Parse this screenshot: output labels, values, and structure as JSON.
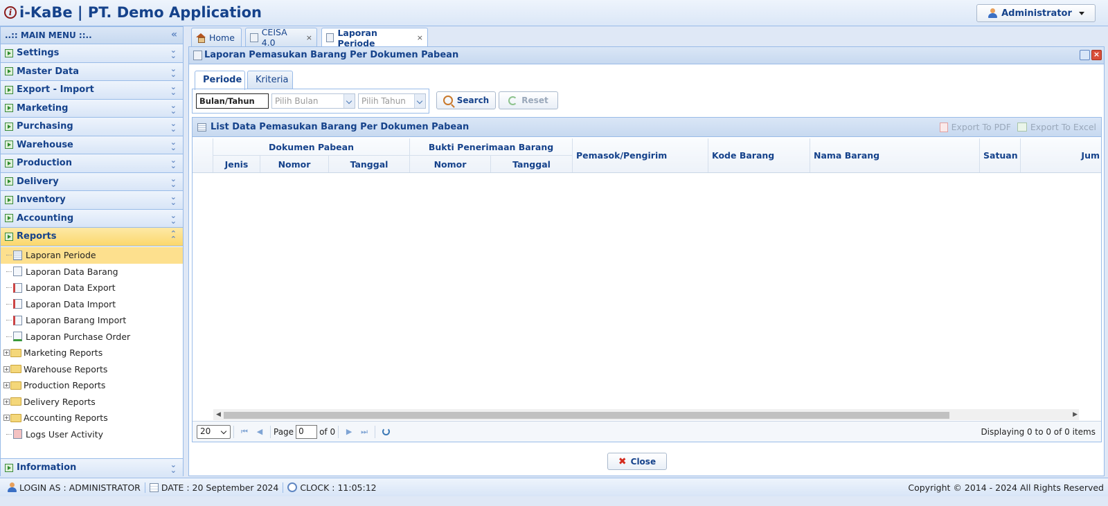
{
  "header": {
    "logo_letter": "i",
    "title": "i-KaBe | PT. Demo Application",
    "user_button": "Administrator"
  },
  "sidebar": {
    "title": "..:: MAIN MENU ::..",
    "menu": [
      "Settings",
      "Master Data",
      "Export - Import",
      "Marketing",
      "Purchasing",
      "Warehouse",
      "Production",
      "Delivery",
      "Inventory",
      "Accounting",
      "Reports"
    ],
    "reports_items": [
      "Laporan Periode",
      "Laporan Data Barang",
      "Laporan Data Export",
      "Laporan Data Import",
      "Laporan Barang Import",
      "Laporan Purchase Order"
    ],
    "report_folders": [
      "Marketing Reports",
      "Warehouse Reports",
      "Production Reports",
      "Delivery Reports",
      "Accounting Reports"
    ],
    "logs_item": "Logs User Activity",
    "information": "Information"
  },
  "tabs": [
    {
      "label": "Home",
      "icon": "home-icon"
    },
    {
      "label": "CEISA 4.0",
      "icon": "pen-icon"
    },
    {
      "label": "Laporan Periode",
      "icon": "calendar-icon",
      "active": true
    }
  ],
  "panel": {
    "title": "Laporan Pemasukan Barang Per Dokumen Pabean",
    "subtabs": [
      "Periode",
      "Kriteria"
    ],
    "filter": {
      "label": "Bulan/Tahun",
      "month_placeholder": "Pilih Bulan",
      "year_placeholder": "Pilih Tahun"
    },
    "search_button": "Search",
    "reset_button": "Reset",
    "grid": {
      "title": "List Data Pemasukan Barang Per Dokumen Pabean",
      "export_pdf": "Export To PDF",
      "export_excel": "Export To Excel",
      "group_dokumen": "Dokumen Pabean",
      "group_bukti": "Bukti Penerimaan Barang",
      "col_jenis": "Jenis",
      "col_nomor": "Nomor",
      "col_tanggal": "Tanggal",
      "col_pemasok": "Pemasok/Pengirim",
      "col_kode": "Kode Barang",
      "col_nama": "Nama Barang",
      "col_satuan": "Satuan",
      "col_jumlah": "Jum"
    },
    "pager": {
      "page_size": "20",
      "page_label": "Page",
      "page_value": "0",
      "of_label": "of 0",
      "display": "Displaying 0 to 0 of 0 items"
    },
    "close_button": "Close"
  },
  "footer": {
    "login": "LOGIN AS : ADMINISTRATOR",
    "date": "DATE : 20 September 2024",
    "clock": "CLOCK : 11:05:12",
    "copyright": "Copyright © 2014 - 2024 All Rights Reserved"
  }
}
